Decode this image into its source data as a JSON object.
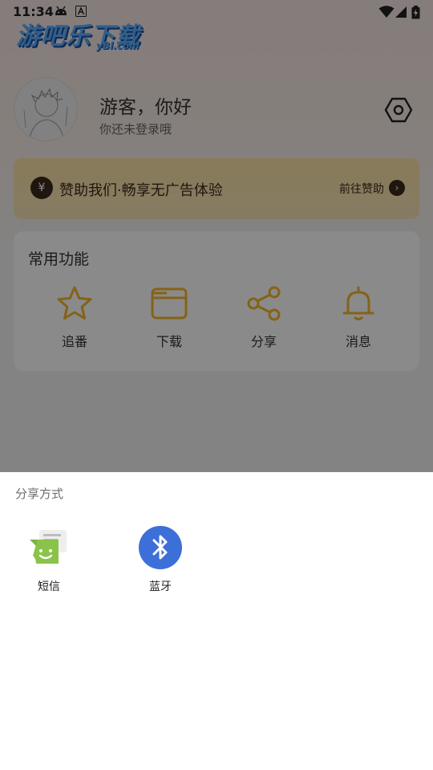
{
  "status_bar": {
    "time": "11:34"
  },
  "watermark": {
    "title": "游吧乐下载",
    "sub": "yBl.com"
  },
  "profile": {
    "name": "游客，你好",
    "subtitle": "你还未登录哦"
  },
  "sponsor": {
    "icon_glyph": "¥",
    "text": "赞助我们·畅享无广告体验",
    "action": "前往赞助",
    "arrow_glyph": "›"
  },
  "features": {
    "title": "常用功能",
    "items": [
      {
        "label": "追番",
        "icon": "star-icon"
      },
      {
        "label": "下载",
        "icon": "folder-icon"
      },
      {
        "label": "分享",
        "icon": "share-icon"
      },
      {
        "label": "消息",
        "icon": "bell-icon"
      }
    ],
    "accent_color": "#f5b52e"
  },
  "share_sheet": {
    "title": "分享方式",
    "targets": [
      {
        "label": "短信",
        "icon": "sms-icon"
      },
      {
        "label": "蓝牙",
        "icon": "bluetooth-icon"
      }
    ]
  },
  "colors": {
    "bluetooth": "#3d6fd8",
    "sms_green": "#8bc34a",
    "overlay": "rgba(0,0,0,0.46)"
  }
}
